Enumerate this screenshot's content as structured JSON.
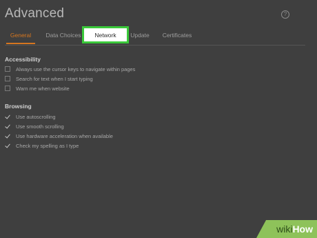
{
  "header": {
    "title": "Advanced",
    "help_icon": "?"
  },
  "tabs": [
    {
      "label": "General"
    },
    {
      "label": "Data Choices"
    },
    {
      "label": "Network"
    },
    {
      "label": "Update"
    },
    {
      "label": "Certificates"
    }
  ],
  "accessibility": {
    "heading": "Accessibility",
    "items": [
      {
        "label": "Always use the cursor keys to navigate within pages",
        "checked": false
      },
      {
        "label": "Search for text when I start typing",
        "checked": false
      },
      {
        "label": "Warn me when website",
        "checked": false
      }
    ]
  },
  "browsing": {
    "heading": "Browsing",
    "items": [
      {
        "label": "Use autoscrolling",
        "checked": true
      },
      {
        "label": "Use smooth scrolling",
        "checked": true
      },
      {
        "label": "Use hardware acceleration when available",
        "checked": true
      },
      {
        "label": "Check my spelling as I type",
        "checked": true
      }
    ]
  },
  "watermark": {
    "wiki": "wiki",
    "how": "How"
  },
  "colors": {
    "accent": "#d6761f",
    "highlight": "#3ac93a",
    "background": "#3f3f3f"
  }
}
